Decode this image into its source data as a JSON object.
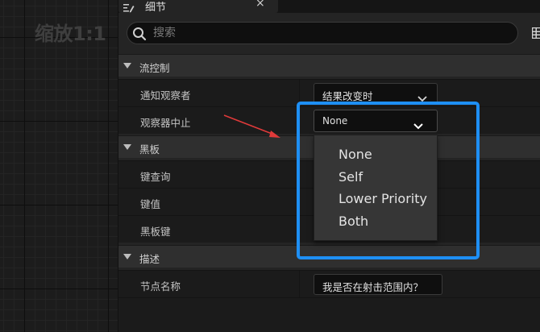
{
  "graph": {
    "zoom_label": "缩放1:1"
  },
  "panel": {
    "tab_title": "细节",
    "tab_close": "×",
    "search_placeholder": "搜索"
  },
  "categories": [
    {
      "label": "流控制"
    },
    {
      "label": "黑板"
    },
    {
      "label": "描述"
    }
  ],
  "properties": {
    "notify_observer": {
      "label": "通知观察者",
      "value": "结果改变时"
    },
    "observer_aborts": {
      "label": "观察器中止",
      "value": "None"
    },
    "key_query": {
      "label": "键查询"
    },
    "key_value": {
      "label": "键值"
    },
    "blackboard_key": {
      "label": "黑板键"
    },
    "node_name": {
      "label": "节点名称",
      "value": "我是否在射击范围内？"
    }
  },
  "dropdown": {
    "options": [
      "None",
      "Self",
      "Lower Priority",
      "Both"
    ]
  },
  "colors": {
    "highlight": "#1e8ff5",
    "arrow": "#e03a3a"
  },
  "icons": [
    "details-tab-icon",
    "search-icon",
    "view-options-icon",
    "chevron-down-icon"
  ]
}
